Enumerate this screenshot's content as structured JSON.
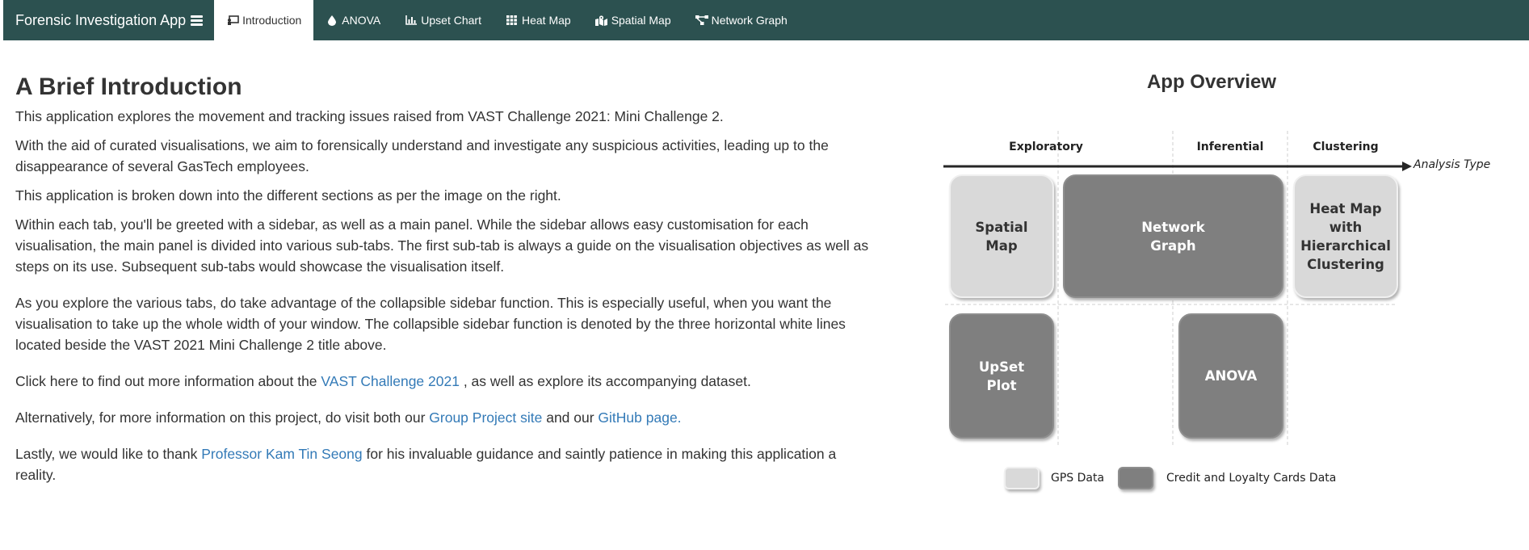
{
  "navbar": {
    "brand": "Forensic Investigation App",
    "tabs": [
      {
        "label": "Introduction",
        "icon": "chalkboard-teacher-icon",
        "active": true
      },
      {
        "label": "ANOVA",
        "icon": "tint-icon"
      },
      {
        "label": "Upset Chart",
        "icon": "bar-chart-icon"
      },
      {
        "label": "Heat Map",
        "icon": "grid-icon"
      },
      {
        "label": "Spatial Map",
        "icon": "map-marked-icon"
      },
      {
        "label": "Network Graph",
        "icon": "project-diagram-icon"
      }
    ],
    "colors": {
      "background": "#2c5150",
      "active_tab": "#ffffff"
    }
  },
  "intro": {
    "heading": "A Brief Introduction",
    "p1": "This application explores the movement and tracking issues raised from VAST Challenge 2021: Mini Challenge 2.",
    "p2": "With the aid of curated visualisations, we aim to forensically understand and investigate any suspicious activities, leading up to the disappearance of several GasTech employees.",
    "p3": "This application is broken down into the different sections as per the image on the right.",
    "p4": "Within each tab, you'll be greeted with a sidebar, as well as a main panel. While the sidebar allows easy customisation for each visualisation, the main panel is divided into various sub-tabs. The first sub-tab is always a guide on the visualisation objectives as well as steps on its use. Subsequent sub-tabs would showcase the visualisation itself.",
    "p5": "As you explore the various tabs, do take advantage of the collapsible sidebar function. This is especially useful, when you want the visualisation to take up the whole width of your window. The collapsible sidebar function is denoted by the three horizontal white lines located beside the VAST 2021 Mini Challenge 2 title above.",
    "p6_pre": "Click here to find out more information about the ",
    "p6_link": "VAST Challenge 2021",
    "p6_post": " , as well as explore its accompanying dataset.",
    "p7_pre": "Alternatively, for more information on this project, do visit both our ",
    "p7_link1": "Group Project site",
    "p7_mid": " and our ",
    "p7_link2": "GitHub page.",
    "p8_pre": "Lastly, we would like to thank ",
    "p8_link": "Professor Kam Tin Seong",
    "p8_post": " for his invaluable guidance and saintly patience in making this application a reality.",
    "link_color": "#337ab7"
  },
  "overview": {
    "title": "App Overview",
    "columns": [
      "Exploratory",
      "Inferential",
      "Clustering"
    ],
    "axis_label": "Analysis Type",
    "boxes": {
      "spatial_map": [
        "Spatial",
        "Map"
      ],
      "network_graph": [
        "Network",
        "Graph"
      ],
      "heat_map": [
        "Heat Map",
        "with",
        "Hierarchical",
        "Clustering"
      ],
      "upset_plot": [
        "UpSet",
        "Plot"
      ],
      "anova": [
        "ANOVA"
      ]
    },
    "legend": [
      {
        "label": "GPS Data",
        "color": "#d9d9d9"
      },
      {
        "label": "Credit and Loyalty Cards Data",
        "color": "#7f7f7f"
      }
    ]
  }
}
